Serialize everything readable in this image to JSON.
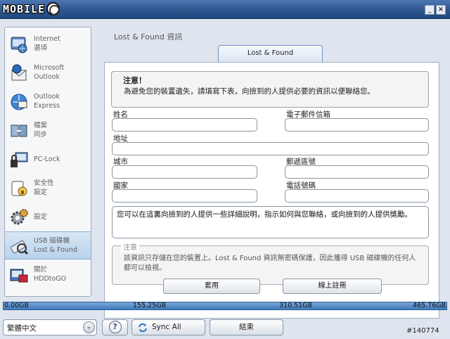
{
  "brand": {
    "logo_text": "MOBILE"
  },
  "window": {
    "minimize": "_",
    "close": "×"
  },
  "sidebar": {
    "items": [
      {
        "line1": "Internet",
        "line2": "選項",
        "icon": "internet-options-icon"
      },
      {
        "line1": "Microsoft",
        "line2": "Outlook",
        "icon": "outlook-icon"
      },
      {
        "line1": "Outlook",
        "line2": "Express",
        "icon": "outlook-express-icon"
      },
      {
        "line1": "檔案",
        "line2": "同步",
        "icon": "file-sync-icon"
      },
      {
        "line1": "PC-Lock",
        "line2": "",
        "icon": "pc-lock-icon"
      },
      {
        "line1": "安全性",
        "line2": "設定",
        "icon": "security-icon"
      },
      {
        "line1": "設定",
        "line2": "",
        "icon": "settings-gear-icon"
      },
      {
        "line1": "USB 磁碟機",
        "line2": "Lost & Found",
        "icon": "usb-lost-found-icon",
        "active": true
      },
      {
        "line1": "關於",
        "line2": "HDDtoGO",
        "icon": "about-icon"
      }
    ]
  },
  "main": {
    "heading": "Lost & Found 資訊",
    "tab": "Lost & Found",
    "notice": {
      "title": "注意！",
      "text": "為避免您的裝置遺失，請填寫下表，向撿到的人提供必要的資訊以便聯絡您。"
    },
    "fields": {
      "name": "姓名",
      "email": "電子郵件信箱",
      "address": "地址",
      "city": "城市",
      "postal": "郵遞區號",
      "country": "國家",
      "phone": "電話號碼"
    },
    "info_text": "您可以在這裏向撿到的人提供一些詳細說明，指示如何與您聯絡，或向撿到的人提供獎勵。",
    "note": {
      "title": "注意",
      "text": "該資訊只存儲在您的裝置上。Lost & Found 資訊無密碼保護，因此獲得 USB 磁碟機的任何人都可以檢視。"
    },
    "buttons": {
      "apply": "套用",
      "register": "線上註冊"
    }
  },
  "storage": {
    "used_fraction": 0.0,
    "ticks": [
      "0.00GB",
      "155.25GB",
      "310.51GB",
      "465.76GB"
    ],
    "colors": {
      "bar": "#3e79ba"
    }
  },
  "footer": {
    "language": "繁體中文",
    "help": "?",
    "sync_all": "Sync All",
    "exit": "結束",
    "watermark": "#140774"
  }
}
